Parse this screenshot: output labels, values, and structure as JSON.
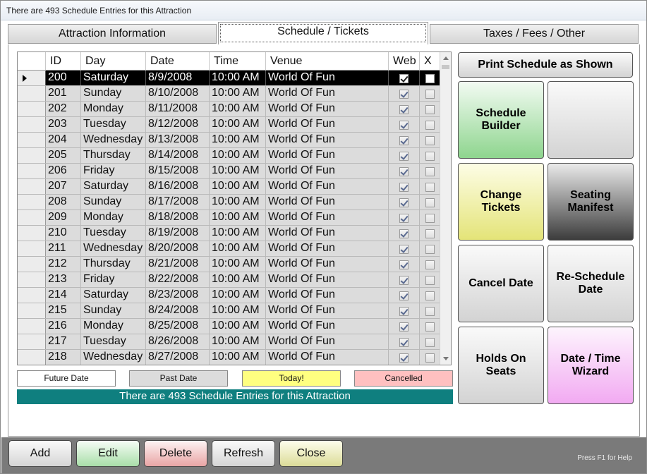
{
  "window": {
    "title": "There are 493 Schedule Entries for this Attraction"
  },
  "tabs": [
    {
      "label": "Attraction Information"
    },
    {
      "label": "Schedule / Tickets"
    },
    {
      "label": "Taxes / Fees / Other"
    }
  ],
  "grid": {
    "columns": [
      "ID",
      "Day",
      "Date",
      "Time",
      "Venue",
      "Web",
      "X"
    ],
    "rows": [
      {
        "id": "200",
        "day": "Saturday",
        "date": "8/9/2008",
        "time": "10:00 AM",
        "venue": "World Of Fun",
        "web": true,
        "x": false
      },
      {
        "id": "201",
        "day": "Sunday",
        "date": "8/10/2008",
        "time": "10:00 AM",
        "venue": "World Of Fun",
        "web": true,
        "x": false
      },
      {
        "id": "202",
        "day": "Monday",
        "date": "8/11/2008",
        "time": "10:00 AM",
        "venue": "World Of Fun",
        "web": true,
        "x": false
      },
      {
        "id": "203",
        "day": "Tuesday",
        "date": "8/12/2008",
        "time": "10:00 AM",
        "venue": "World Of Fun",
        "web": true,
        "x": false
      },
      {
        "id": "204",
        "day": "Wednesday",
        "date": "8/13/2008",
        "time": "10:00 AM",
        "venue": "World Of Fun",
        "web": true,
        "x": false
      },
      {
        "id": "205",
        "day": "Thursday",
        "date": "8/14/2008",
        "time": "10:00 AM",
        "venue": "World Of Fun",
        "web": true,
        "x": false
      },
      {
        "id": "206",
        "day": "Friday",
        "date": "8/15/2008",
        "time": "10:00 AM",
        "venue": "World Of Fun",
        "web": true,
        "x": false
      },
      {
        "id": "207",
        "day": "Saturday",
        "date": "8/16/2008",
        "time": "10:00 AM",
        "venue": "World Of Fun",
        "web": true,
        "x": false
      },
      {
        "id": "208",
        "day": "Sunday",
        "date": "8/17/2008",
        "time": "10:00 AM",
        "venue": "World Of Fun",
        "web": true,
        "x": false
      },
      {
        "id": "209",
        "day": "Monday",
        "date": "8/18/2008",
        "time": "10:00 AM",
        "venue": "World Of Fun",
        "web": true,
        "x": false
      },
      {
        "id": "210",
        "day": "Tuesday",
        "date": "8/19/2008",
        "time": "10:00 AM",
        "venue": "World Of Fun",
        "web": true,
        "x": false
      },
      {
        "id": "211",
        "day": "Wednesday",
        "date": "8/20/2008",
        "time": "10:00 AM",
        "venue": "World Of Fun",
        "web": true,
        "x": false
      },
      {
        "id": "212",
        "day": "Thursday",
        "date": "8/21/2008",
        "time": "10:00 AM",
        "venue": "World Of Fun",
        "web": true,
        "x": false
      },
      {
        "id": "213",
        "day": "Friday",
        "date": "8/22/2008",
        "time": "10:00 AM",
        "venue": "World Of Fun",
        "web": true,
        "x": false
      },
      {
        "id": "214",
        "day": "Saturday",
        "date": "8/23/2008",
        "time": "10:00 AM",
        "venue": "World Of Fun",
        "web": true,
        "x": false
      },
      {
        "id": "215",
        "day": "Sunday",
        "date": "8/24/2008",
        "time": "10:00 AM",
        "venue": "World Of Fun",
        "web": true,
        "x": false
      },
      {
        "id": "216",
        "day": "Monday",
        "date": "8/25/2008",
        "time": "10:00 AM",
        "venue": "World Of Fun",
        "web": true,
        "x": false
      },
      {
        "id": "217",
        "day": "Tuesday",
        "date": "8/26/2008",
        "time": "10:00 AM",
        "venue": "World Of Fun",
        "web": true,
        "x": false
      },
      {
        "id": "218",
        "day": "Wednesday",
        "date": "8/27/2008",
        "time": "10:00 AM",
        "venue": "World Of Fun",
        "web": true,
        "x": false
      }
    ]
  },
  "legend": [
    {
      "label": "Future Date",
      "color": "#ffffff"
    },
    {
      "label": "Past Date",
      "color": "#dcdcdc"
    },
    {
      "label": "Today!",
      "color": "#ffff80"
    },
    {
      "label": "Cancelled",
      "color": "#ffc0c0"
    }
  ],
  "status_text": "There are 493 Schedule Entries for this Attraction",
  "actions": {
    "print": "Print Schedule as Shown",
    "schedule_builder": "Schedule Builder",
    "blank": "",
    "change_tickets": "Change Tickets",
    "seating_manifest": "Seating Manifest",
    "cancel_date": "Cancel Date",
    "reschedule_date": "Re-Schedule Date",
    "holds_on_seats": "Holds On Seats",
    "date_time_wizard": "Date / Time Wizard"
  },
  "footer": {
    "add": "Add",
    "edit": "Edit",
    "delete": "Delete",
    "refresh": "Refresh",
    "close": "Close",
    "help": "Press F1 for Help"
  }
}
